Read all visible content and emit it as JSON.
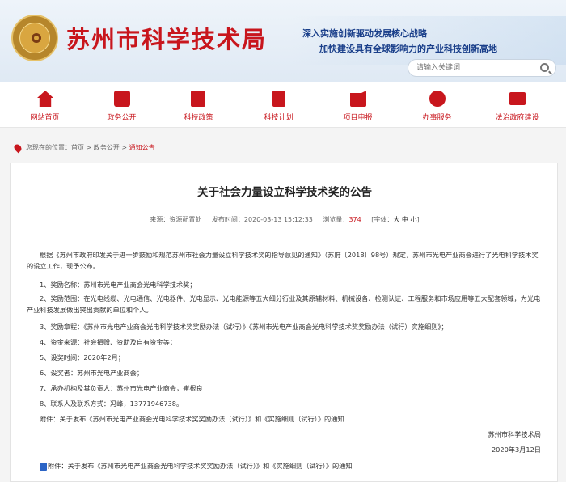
{
  "header": {
    "site_title": "苏州市科学技术局",
    "slogan_line1": "深入实施创新驱动发展核心战略",
    "slogan_line2": "加快建设具有全球影响力的产业科技创新高地",
    "search_placeholder": "请输入关键词"
  },
  "nav": [
    {
      "label": "网站首页",
      "icon": "home-icon"
    },
    {
      "label": "政务公开",
      "icon": "newspaper-icon"
    },
    {
      "label": "科技政策",
      "icon": "document-icon"
    },
    {
      "label": "科技计划",
      "icon": "clipboard-icon"
    },
    {
      "label": "项目申报",
      "icon": "edit-icon"
    },
    {
      "label": "办事服务",
      "icon": "atom-icon"
    },
    {
      "label": "法治政府建设",
      "icon": "monitor-icon"
    }
  ],
  "breadcrumb": {
    "prefix": "您现在的位置：",
    "items": [
      "首页",
      "政务公开",
      "通知公告"
    ],
    "sep": " > "
  },
  "article": {
    "title": "关于社会力量设立科学技术奖的公告",
    "source_label": "来源：",
    "source": "资源配置处",
    "date_label": "发布时间：",
    "date": "2020-03-13 15:12:33",
    "views_label": "浏览量：",
    "views": "374",
    "font_label": "[字体：",
    "font_sizes": "大 中 小",
    "font_close": "]",
    "intro": "根据《苏州市政府印发关于进一步鼓励和规范苏州市社会力量设立科学技术奖的指导意见的通知》（苏府〔2018〕98号）规定，苏州市光电产业商会进行了光电科学技术奖的设立工作，现予公布。",
    "item1": "1、奖励名称：苏州市光电产业商会光电科学技术奖；",
    "item2": "2、奖励范围：在光电线缆、光电通信、光电器件、光电显示、光电能源等五大细分行业及其原辅材料、机械设备、检测认证、工程服务和市场应用等五大配套领域，为光电产业科技发展做出突出贡献的单位和个人。",
    "item3": "3、奖励章程：《苏州市光电产业商会光电科学技术奖奖励办法（试行）》《苏州市光电产业商会光电科学技术奖奖励办法（试行）实施细则》；",
    "item4": "4、资金来源：社会捐赠、资助及自有资金等；",
    "item5": "5、设奖时间：2020年2月；",
    "item6": "6、设奖者：苏州市光电产业商会；",
    "item7": "7、承办机构及其负责人：苏州市光电产业商会，崔根良",
    "item8": "8、联系人及联系方式：冯峰，13771946738。",
    "attachment_note": "附件：关于发布《苏州市光电产业商会光电科学技术奖奖励办法（试行）》和《实施细则（试行）》的通知",
    "signature": "苏州市科学技术局",
    "sign_date": "2020年3月12日",
    "attachment_link": "附件：关于发布《苏州市光电产业商会光电科学技术奖奖励办法（试行）》和《实施细则（试行）》的通知"
  }
}
